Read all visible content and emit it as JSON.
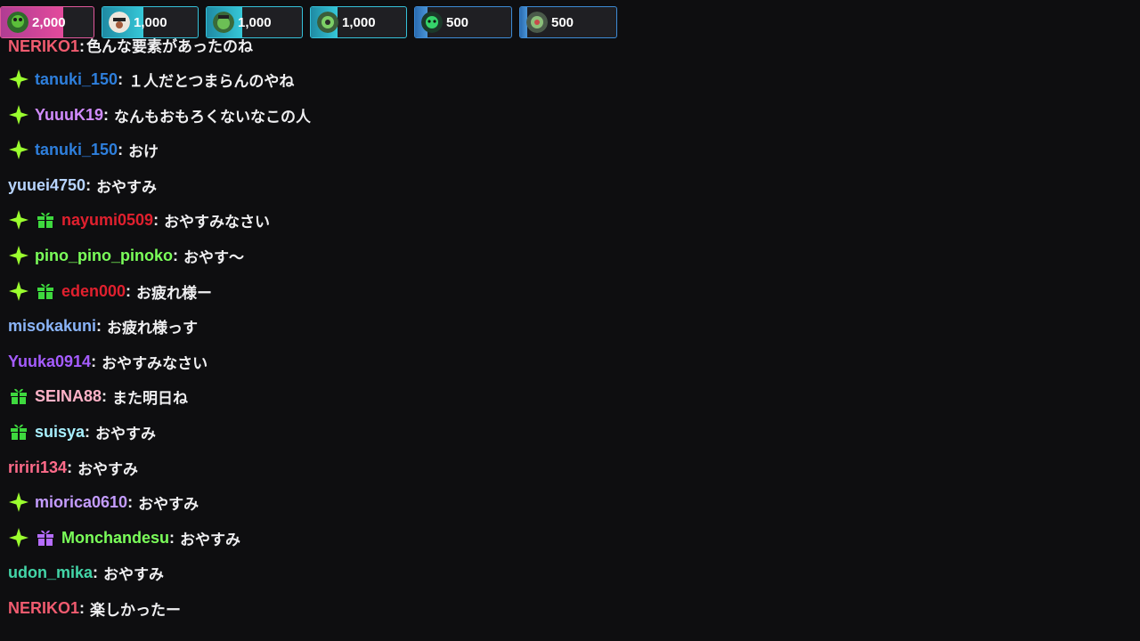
{
  "leaderboard": [
    {
      "amount": "2,000",
      "avatar": "green-creature-avatar"
    },
    {
      "amount": "1,000",
      "avatar": "face-avatar"
    },
    {
      "amount": "1,000",
      "avatar": "green-creature-avatar"
    },
    {
      "amount": "1,000",
      "avatar": "green-creature-avatar"
    },
    {
      "amount": "500",
      "avatar": "green-creature-avatar"
    },
    {
      "amount": "500",
      "avatar": "green-creature-avatar"
    }
  ],
  "partial_top": {
    "user": "NERIKO1",
    "text": "色んな要素があったのね"
  },
  "messages": [
    {
      "badges": [
        "sparkle"
      ],
      "user": "tanuki_150",
      "color": "#2e7fdc",
      "text": "１人だとつまらんのやね"
    },
    {
      "badges": [
        "sparkle"
      ],
      "user": "YuuuK19",
      "color": "#d18cff",
      "text": "なんもおもろくないなこの人"
    },
    {
      "badges": [
        "sparkle"
      ],
      "user": "tanuki_150",
      "color": "#2e7fdc",
      "text": "おけ"
    },
    {
      "badges": [],
      "user": "yuuei4750",
      "color": "#b7d4ff",
      "text": "おやすみ"
    },
    {
      "badges": [
        "sparkle",
        "gift-green"
      ],
      "user": "nayumi0509",
      "color": "#e0202e",
      "text": "おやすみなさい"
    },
    {
      "badges": [
        "sparkle"
      ],
      "user": "pino_pino_pinoko",
      "color": "#7bff5a",
      "text": "おやす〜"
    },
    {
      "badges": [
        "sparkle",
        "gift-green"
      ],
      "user": "eden000",
      "color": "#e0202e",
      "text": "お疲れ様ー"
    },
    {
      "badges": [],
      "user": "misokakuni",
      "color": "#8ab4f8",
      "text": "お疲れ様っす"
    },
    {
      "badges": [],
      "user": "Yuuka0914",
      "color": "#a55cff",
      "text": "おやすみなさい"
    },
    {
      "badges": [
        "gift-green"
      ],
      "user": "SEINA88",
      "color": "#ffb3c8",
      "text": "また明日ね"
    },
    {
      "badges": [
        "gift-green"
      ],
      "user": "suisya",
      "color": "#a8f0ff",
      "text": "おやすみ"
    },
    {
      "badges": [],
      "user": "ririri134",
      "color": "#ff6b8a",
      "text": "おやすみ"
    },
    {
      "badges": [
        "sparkle"
      ],
      "user": "miorica0610",
      "color": "#c49cff",
      "text": "おやすみ"
    },
    {
      "badges": [
        "sparkle",
        "gift-purple"
      ],
      "user": "Monchandesu",
      "color": "#7bff5a",
      "text": "おやすみ"
    },
    {
      "badges": [],
      "user": "udon_mika",
      "color": "#43d6a8",
      "text": "おやすみ"
    },
    {
      "badges": [],
      "user": "NERIKO1",
      "color": "#f05b6f",
      "text": "楽しかったー"
    }
  ],
  "partial_bottom": {
    "text": "..."
  },
  "colors": {
    "background": "#0e0e10",
    "text": "#efeff1",
    "sparkle": "#9bff2e",
    "gift_green": "#3ed93e",
    "gift_purple": "#b66dff"
  }
}
